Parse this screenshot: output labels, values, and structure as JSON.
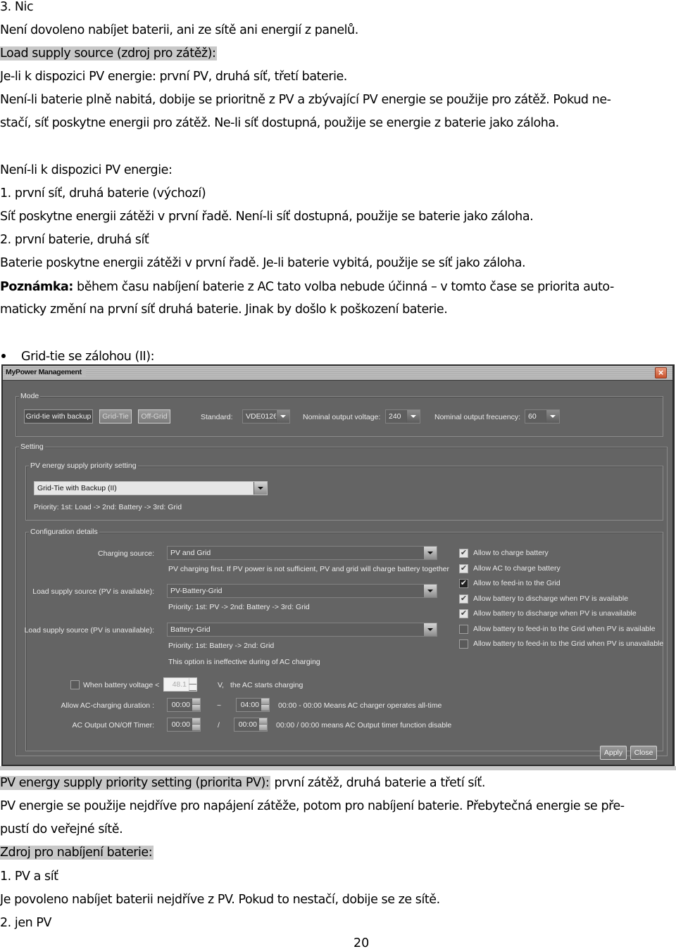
{
  "document": {
    "top_lines": [
      {
        "text": "3.  Nic"
      },
      {
        "text": "Není dovoleno nabíjet baterii, ani ze sítě ani energií z panelů."
      },
      {
        "text": "Load supply source (zdroj pro zátěž):",
        "highlight": true
      },
      {
        "text": "Je-li k dispozici PV energie: první PV, druhá síť, třetí baterie."
      },
      {
        "text": "Není-li baterie plně nabitá, dobije se prioritně z PV a zbývající PV energie se použije pro zátěž. Pokud ne-"
      },
      {
        "text": "stačí, síť poskytne energii pro zátěž. Ne-li síť dostupná, použije se energie z baterie jako záloha."
      },
      {
        "text": "Není-li k dispozici PV energie:"
      },
      {
        "text": "1.  první síť, druhá baterie (výchozí)"
      },
      {
        "text": "Síť poskytne energii zátěži v první řadě. Není-li síť dostupná, použije se baterie jako záloha."
      },
      {
        "text": "2.  první baterie, druhá síť"
      },
      {
        "text": "Baterie poskytne energii zátěži v první řadě. Je-li baterie vybitá, použije se síť jako záloha."
      }
    ],
    "note_bold": "Poznámka:",
    "note_rest_1": " během času nabíjení baterie z AC tato volba nebude účinná – v tomto čase se priorita auto-",
    "note_rest_2": "maticky změní na první síť druhá baterie. Jinak by došlo k poškození baterie.",
    "bullet_heading": "Grid-tie se zálohou (II):",
    "bottom": {
      "pv_priority_highlight": "PV energy supply priority setting (priorita PV):",
      "pv_priority_rest": " první zátěž, druhá baterie a třetí síť.",
      "line2": "PV energie se použije nejdříve pro napájení zátěže, potom pro nabíjení baterie. Přebytečná energie se pře-",
      "line3": "pustí do veřejné sítě.",
      "charging_source_heading": "Zdroj pro nabíjení baterie:",
      "item1": "1.  PV a síť",
      "item1_desc": "Je povoleno nabíjet baterii nejdříve z PV. Pokud to nestačí, dobije se ze sítě.",
      "item2": "2.  jen PV"
    },
    "page_number": "20"
  },
  "window": {
    "title": "MyPower Management",
    "close_icon": "close-x-icon",
    "mode": {
      "legend": "Mode",
      "buttons": [
        {
          "label": "Grid-tie with backup",
          "selected": true
        },
        {
          "label": "Grid-Tie",
          "selected": false
        },
        {
          "label": "Off-Grid",
          "selected": false
        }
      ],
      "standard_label": "Standard:",
      "standard_value": "VDE0126",
      "voltage_label": "Nominal output voltage:",
      "voltage_value": "240",
      "frequency_label": "Nominal output frecuency:",
      "frequency_value": "60"
    },
    "setting": {
      "legend": "Setting",
      "pv_priority": {
        "legend": "PV energy supply priority setting",
        "value": "Grid-Tie with Backup (II)",
        "description": "Priority: 1st: Load -> 2nd: Battery -> 3rd: Grid"
      },
      "config": {
        "legend": "Configuration details",
        "charging_source_label": "Charging source:",
        "charging_source_value": "PV and Grid",
        "charging_source_desc": "PV charging first. If PV power is not sufficient, PV and grid will charge battery together",
        "load_pv_available_label": "Load supply source (PV is available):",
        "load_pv_available_value": "PV-Battery-Grid",
        "load_pv_available_desc": "Priority: 1st: PV -> 2nd: Battery -> 3rd: Grid",
        "load_pv_unavailable_label": "Load supply source (PV is unavailable):",
        "load_pv_unavailable_value": "Battery-Grid",
        "load_pv_unavailable_desc": "Priority: 1st: Battery -> 2nd: Grid",
        "ac_charging_note": "This option is ineffective during of AC charging",
        "checkboxes": [
          {
            "label": "Allow to charge battery",
            "checked": true
          },
          {
            "label": "Allow AC to charge battery",
            "checked": true
          },
          {
            "label": "Allow to feed-in to the Grid",
            "checked": true,
            "style": "dark"
          },
          {
            "label": "Allow battery to discharge when PV is available",
            "checked": true
          },
          {
            "label": "Allow battery to discharge when PV is unavailable",
            "checked": true
          },
          {
            "label": "Allow battery to feed-in to the Grid when PV is available",
            "checked": false
          },
          {
            "label": "Allow battery to feed-in to the Grid when PV is unavailable",
            "checked": false
          }
        ],
        "battery_voltage": {
          "checked": false,
          "label": "When battery voltage <",
          "value": "48.1",
          "unit": "V,",
          "suffix": "the AC starts charging"
        },
        "ac_charging_duration": {
          "label": "Allow AC-charging duration :",
          "start": "00:00",
          "separator": "~",
          "end": "04:00",
          "hint": "00:00  -  00:00 Means AC charger operates all-time"
        },
        "ac_output_timer": {
          "label": "AC Output ON/Off Timer:",
          "on": "00:00",
          "separator": "/",
          "off": "00:00",
          "hint": "00:00 / 00:00 means AC Output timer function disable"
        }
      }
    },
    "buttons": {
      "apply": "Apply",
      "close": "Close"
    }
  }
}
